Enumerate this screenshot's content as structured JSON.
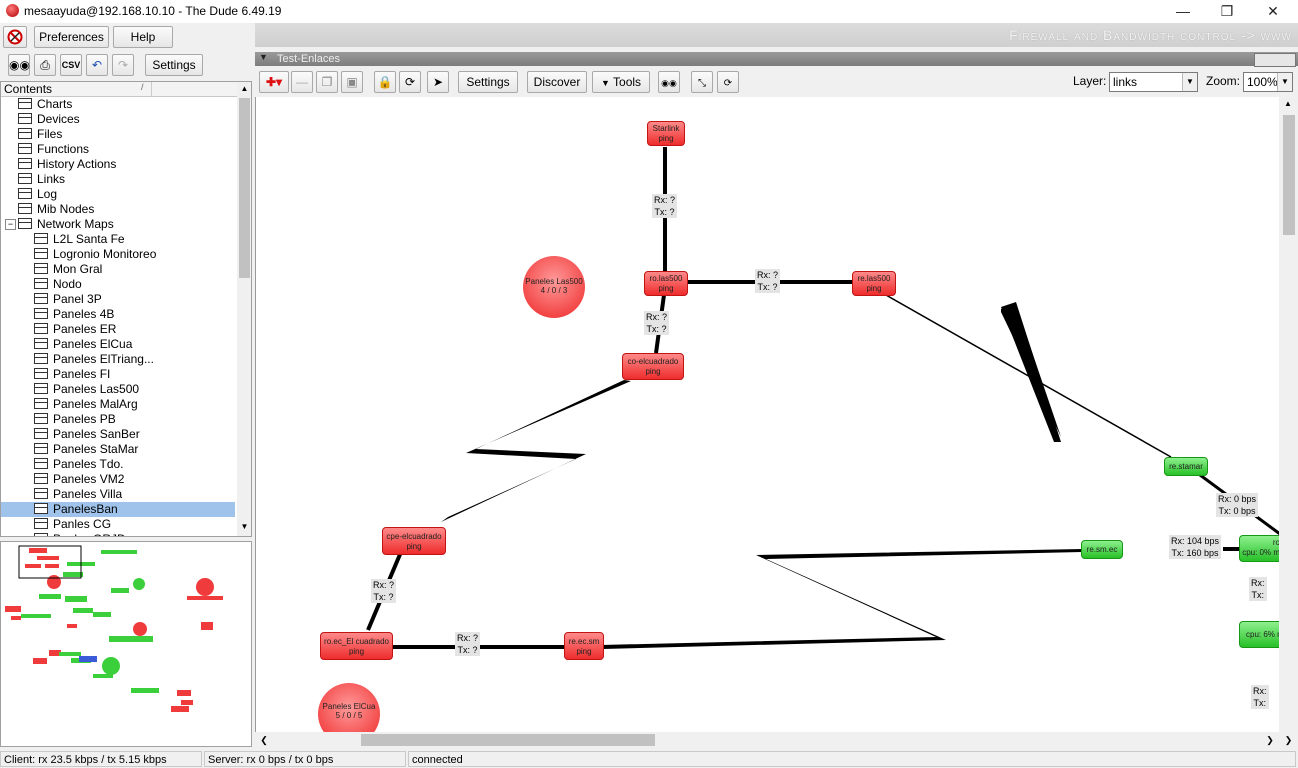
{
  "window": {
    "title": "mesaayuda@192.168.10.10 - The Dude 6.49.19",
    "minimize": "—",
    "maximize": "❐",
    "close": "✕"
  },
  "toolbar": {
    "preferences": "Preferences",
    "help": "Help",
    "settings": "Settings",
    "csv": "CSV"
  },
  "banner": {
    "text": "Firewall and Bandwidth control -> www"
  },
  "tree": {
    "header": "Contents",
    "sort_arrow": "/",
    "items": [
      {
        "label": "Charts"
      },
      {
        "label": "Devices"
      },
      {
        "label": "Files"
      },
      {
        "label": "Functions"
      },
      {
        "label": "History Actions"
      },
      {
        "label": "Links"
      },
      {
        "label": "Log"
      },
      {
        "label": "Mib Nodes"
      },
      {
        "label": "Network Maps"
      },
      {
        "label": "L2L Santa Fe"
      },
      {
        "label": "Logronio Monitoreo"
      },
      {
        "label": "Mon Gral"
      },
      {
        "label": "Nodo"
      },
      {
        "label": "Panel 3P"
      },
      {
        "label": "Paneles 4B"
      },
      {
        "label": "Paneles ER"
      },
      {
        "label": "Paneles ElCua"
      },
      {
        "label": "Paneles ElTriang..."
      },
      {
        "label": "Paneles FI"
      },
      {
        "label": "Paneles Las500"
      },
      {
        "label": "Paneles MalArg"
      },
      {
        "label": "Paneles PB"
      },
      {
        "label": "Paneles SanBer"
      },
      {
        "label": "Paneles StaMar"
      },
      {
        "label": "Paneles Tdo."
      },
      {
        "label": "Paneles VM2"
      },
      {
        "label": "Paneles Villa"
      },
      {
        "label": "PanelesBan"
      },
      {
        "label": "Panles CG"
      },
      {
        "label": "Panles GRJD"
      }
    ],
    "collapse_glyph": "−"
  },
  "map_panel": {
    "title": "Test-Enlaces",
    "settings": "Settings",
    "discover": "Discover",
    "tools": "Tools",
    "layer_label": "Layer:",
    "layer_value": "links",
    "zoom_label": "Zoom:",
    "zoom_value": "100%"
  },
  "map": {
    "nodes": {
      "starlink": {
        "name": "Starlink",
        "sub": "ping"
      },
      "ro_las500": {
        "name": "ro.las500",
        "sub": "ping"
      },
      "re_las500": {
        "name": "re.las500",
        "sub": "ping"
      },
      "co_elcuadrado": {
        "name": "co-elcuadrado",
        "sub": "ping"
      },
      "cpe_elcuadrado": {
        "name": "cpe-elcuadrado",
        "sub": "ping"
      },
      "ro_ec": {
        "name": "ro.ec_El cuadrado",
        "sub": "ping"
      },
      "re_ec_sm": {
        "name": "re.ec.sm",
        "sub": "ping"
      },
      "re_stamar": {
        "name": "re.stamar"
      },
      "re_sm_ec": {
        "name": "re.sm.ec"
      },
      "green_right1": {
        "name": "ro",
        "sub": "cpu: 0% m"
      },
      "green_right2": {
        "name": "cpu: 6% m"
      },
      "paneles_las500": {
        "name": "Paneles Las500",
        "sub": "4 / 0 / 3"
      },
      "paneles_elcua": {
        "name": "Paneles ElCua",
        "sub": "5 / 0 / 5"
      }
    },
    "links": {
      "l1": {
        "rx": "Rx: ?",
        "tx": "Tx: ?"
      },
      "l2": {
        "rx": "Rx: ?",
        "tx": "Tx: ?"
      },
      "l3": {
        "rx": "Rx: ?",
        "tx": "Tx: ?"
      },
      "l4": {
        "rx": "Rx: ?",
        "tx": "Tx: ?"
      },
      "l5": {
        "rx": "Rx: ?",
        "tx": "Tx: ?"
      },
      "l6": {
        "rx": "Rx: 0 bps",
        "tx": "Tx: 0 bps"
      },
      "l7": {
        "rx": "Rx: 104 bps",
        "tx": "Tx: 160 bps"
      },
      "l8": {
        "rx": "Rx:",
        "tx": "Tx:"
      },
      "l9": {
        "rx": "Rx:",
        "tx": "Tx:"
      }
    }
  },
  "status": {
    "client": "Client: rx 23.5 kbps / tx 5.15 kbps",
    "server": "Server: rx 0 bps / tx 0 bps",
    "connection": "connected"
  },
  "colors": {
    "node_down": "#ee2c2c",
    "node_up": "#28c028",
    "selection": "#9fc3ea"
  }
}
